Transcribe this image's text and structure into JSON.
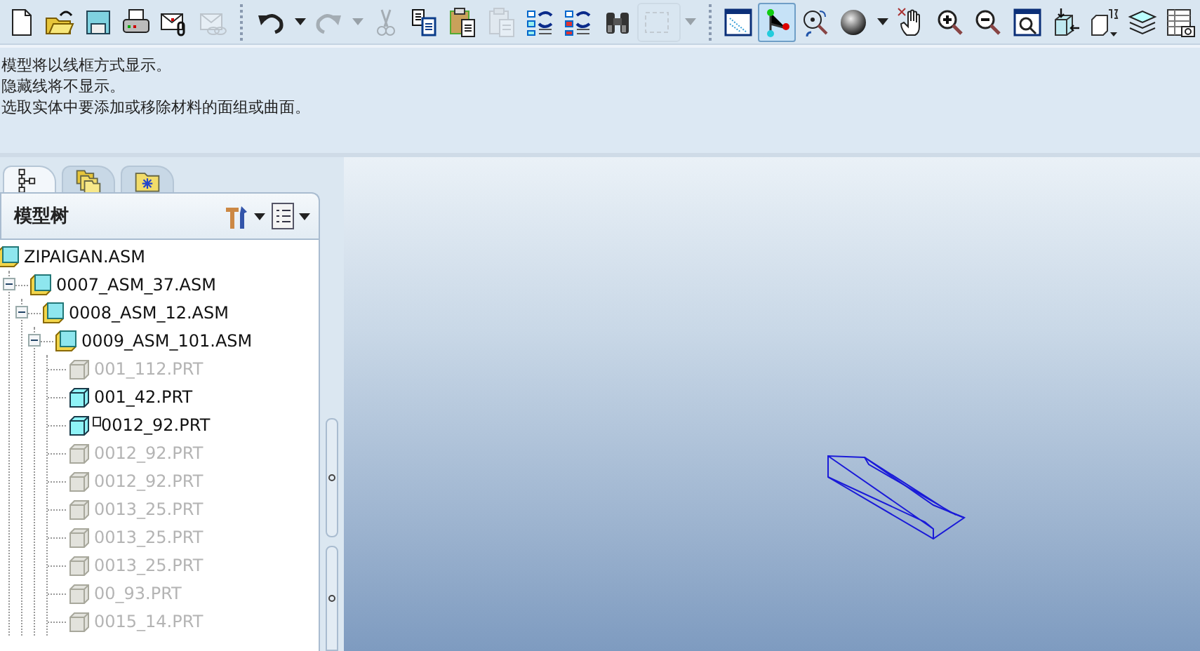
{
  "toolbar_groups": [
    [
      {
        "kind": "new",
        "disabled": false,
        "selected": false,
        "dropdown": false
      },
      {
        "kind": "open",
        "disabled": false,
        "selected": false,
        "dropdown": false
      },
      {
        "kind": "save",
        "disabled": false,
        "selected": false,
        "dropdown": false
      },
      {
        "kind": "print",
        "disabled": false,
        "selected": false,
        "dropdown": false
      },
      {
        "kind": "mail",
        "disabled": false,
        "selected": false,
        "dropdown": false
      },
      {
        "kind": "maillink",
        "disabled": true,
        "selected": false,
        "dropdown": false
      }
    ],
    [
      {
        "kind": "undo",
        "disabled": false,
        "selected": false,
        "dropdown": true
      },
      {
        "kind": "redo",
        "disabled": true,
        "selected": false,
        "dropdown": true
      },
      {
        "kind": "cut",
        "disabled": true,
        "selected": false,
        "dropdown": false
      },
      {
        "kind": "copy",
        "disabled": false,
        "selected": false,
        "dropdown": false
      },
      {
        "kind": "paste",
        "disabled": false,
        "selected": false,
        "dropdown": false
      },
      {
        "kind": "pastespecial",
        "disabled": true,
        "selected": false,
        "dropdown": false
      },
      {
        "kind": "regen",
        "disabled": false,
        "selected": false,
        "dropdown": false
      },
      {
        "kind": "regenmanager",
        "disabled": false,
        "selected": false,
        "dropdown": false
      },
      {
        "kind": "find",
        "disabled": false,
        "selected": false,
        "dropdown": false
      },
      {
        "kind": "selectbox",
        "disabled": true,
        "selected": false,
        "dropdown": true
      }
    ],
    [
      {
        "kind": "datum",
        "disabled": false,
        "selected": false,
        "dropdown": false
      },
      {
        "kind": "network",
        "disabled": false,
        "selected": true,
        "dropdown": false
      },
      {
        "kind": "spin",
        "disabled": false,
        "selected": false,
        "dropdown": false
      },
      {
        "kind": "shade",
        "disabled": false,
        "selected": false,
        "dropdown": true
      },
      {
        "kind": "pan",
        "disabled": false,
        "selected": false,
        "dropdown": false
      },
      {
        "kind": "zoomin",
        "disabled": false,
        "selected": false,
        "dropdown": false
      },
      {
        "kind": "zoomout",
        "disabled": false,
        "selected": false,
        "dropdown": false
      },
      {
        "kind": "refit",
        "disabled": false,
        "selected": false,
        "dropdown": false
      },
      {
        "kind": "orient",
        "disabled": false,
        "selected": false,
        "dropdown": false
      },
      {
        "kind": "views",
        "disabled": false,
        "selected": false,
        "dropdown": false
      },
      {
        "kind": "layers",
        "disabled": false,
        "selected": false,
        "dropdown": false
      },
      {
        "kind": "table",
        "disabled": false,
        "selected": false,
        "dropdown": false
      }
    ]
  ],
  "messages": [
    "模型将以线框方式显示。",
    "隐藏线将不显示。",
    "选取实体中要添加或移除材料的面组或曲面。"
  ],
  "panel_tabs": [
    {
      "kind": "tree",
      "selected": true
    },
    {
      "kind": "folders",
      "selected": false
    },
    {
      "kind": "favorites",
      "selected": false
    }
  ],
  "model_tree": {
    "title": "模型树",
    "root": {
      "label": "ZIPAIGAN.ASM",
      "kind": "asm",
      "disabled": false,
      "marked": false,
      "children": [
        {
          "label": "0007_ASM_37.ASM",
          "kind": "asm",
          "disabled": false,
          "marked": false,
          "expanded": true,
          "children": [
            {
              "label": "0008_ASM_12.ASM",
              "kind": "asm",
              "disabled": false,
              "marked": false,
              "expanded": true,
              "children": [
                {
                  "label": "0009_ASM_101.ASM",
                  "kind": "asm",
                  "disabled": false,
                  "marked": false,
                  "expanded": true,
                  "children": [
                    {
                      "label": "001_112.PRT",
                      "kind": "prt",
                      "disabled": true,
                      "marked": false
                    },
                    {
                      "label": "001_42.PRT",
                      "kind": "prt",
                      "disabled": false,
                      "marked": false
                    },
                    {
                      "label": "0012_92.PRT",
                      "kind": "prt",
                      "disabled": false,
                      "marked": true
                    },
                    {
                      "label": "0012_92.PRT",
                      "kind": "prt",
                      "disabled": true,
                      "marked": false
                    },
                    {
                      "label": "0012_92.PRT",
                      "kind": "prt",
                      "disabled": true,
                      "marked": false
                    },
                    {
                      "label": "0013_25.PRT",
                      "kind": "prt",
                      "disabled": true,
                      "marked": false
                    },
                    {
                      "label": "0013_25.PRT",
                      "kind": "prt",
                      "disabled": true,
                      "marked": false
                    },
                    {
                      "label": "0013_25.PRT",
                      "kind": "prt",
                      "disabled": true,
                      "marked": false
                    },
                    {
                      "label": "00_93.PRT",
                      "kind": "prt",
                      "disabled": true,
                      "marked": false
                    },
                    {
                      "label": "0015_14.PRT",
                      "kind": "prt",
                      "disabled": true,
                      "marked": false
                    }
                  ]
                }
              ]
            }
          ]
        }
      ]
    }
  }
}
